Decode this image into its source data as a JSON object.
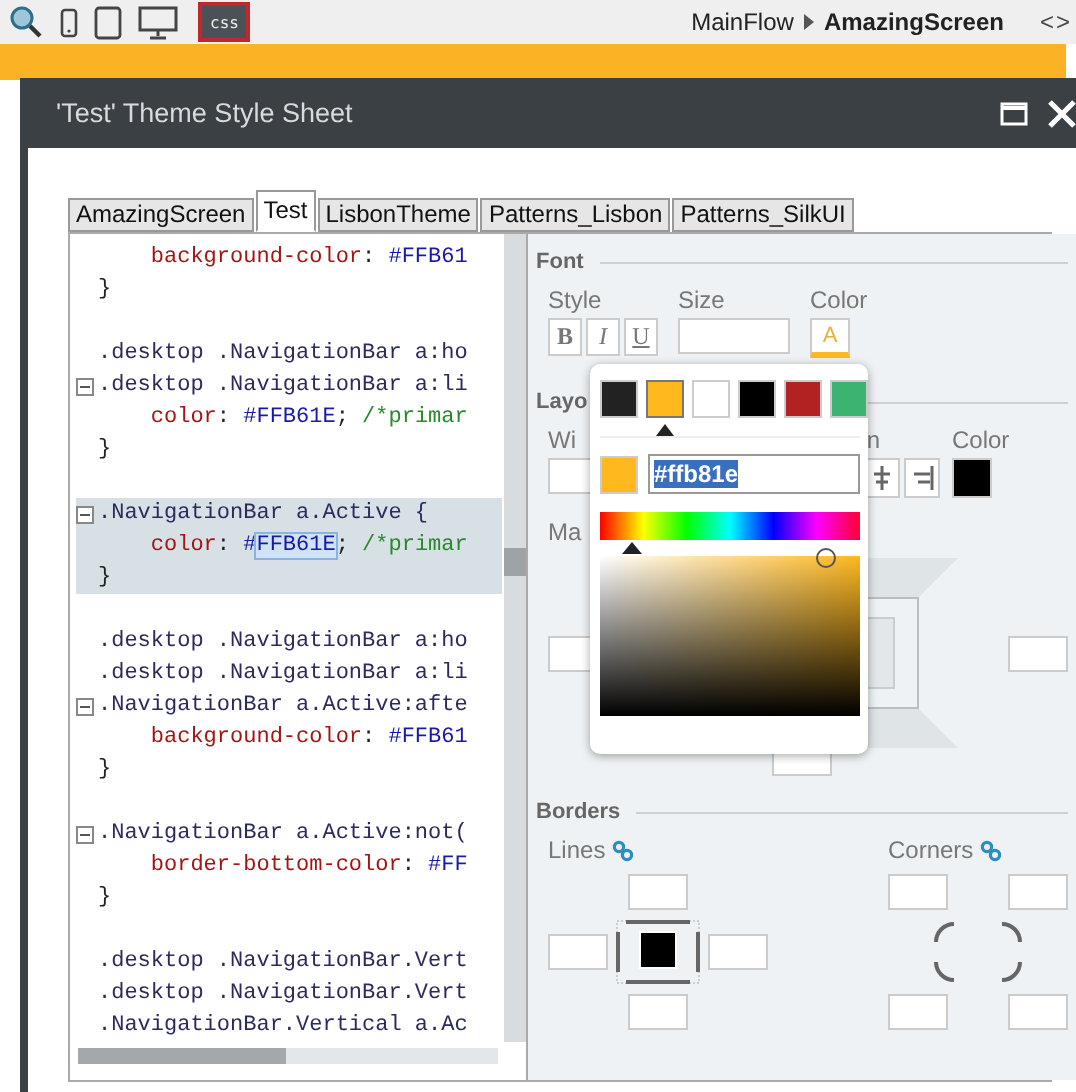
{
  "toolbar": {
    "buttons": [
      {
        "kind": "search",
        "selected": false
      },
      {
        "kind": "phone",
        "selected": false
      },
      {
        "kind": "tablet",
        "selected": false
      },
      {
        "kind": "desktop",
        "selected": false
      },
      {
        "kind": "css",
        "label": "css",
        "selected": true
      }
    ]
  },
  "breadcrumb": {
    "items": [
      "MainFlow",
      "AmazingScreen"
    ],
    "toggle": "<>"
  },
  "dialog": {
    "title": "'Test' Theme Style Sheet"
  },
  "tabs": [
    {
      "label": "AmazingScreen",
      "selected": false
    },
    {
      "label": "Test",
      "selected": true
    },
    {
      "label": "LisbonTheme",
      "selected": false
    },
    {
      "label": "Patterns_Lisbon",
      "selected": false
    },
    {
      "label": "Patterns_SilkUI",
      "selected": false
    }
  ],
  "code": {
    "lines": [
      {
        "fold": false,
        "highlighted": false,
        "parts": [
          {
            "kind": "prop",
            "text": "    background-color"
          },
          {
            "kind": "plain",
            "text": ": "
          },
          {
            "kind": "value",
            "text": "#FFB61"
          }
        ]
      },
      {
        "fold": false,
        "highlighted": false,
        "parts": [
          {
            "kind": "plain",
            "text": "}"
          }
        ]
      },
      {
        "fold": false,
        "highlighted": false
      },
      {
        "fold": false,
        "highlighted": false,
        "parts": [
          {
            "kind": "selector",
            "text": ".desktop .NavigationBar a:ho"
          }
        ]
      },
      {
        "fold": true,
        "highlighted": false,
        "parts": [
          {
            "kind": "selector",
            "text": ".desktop .NavigationBar a:li"
          }
        ]
      },
      {
        "fold": false,
        "highlighted": false,
        "parts": [
          {
            "kind": "prop",
            "text": "    color"
          },
          {
            "kind": "plain",
            "text": ": "
          },
          {
            "kind": "value",
            "text": "#FFB61E"
          },
          {
            "kind": "plain",
            "text": "; "
          },
          {
            "kind": "comment",
            "text": "/*primar"
          }
        ]
      },
      {
        "fold": false,
        "highlighted": false,
        "parts": [
          {
            "kind": "plain",
            "text": "}"
          }
        ]
      },
      {
        "fold": false,
        "highlighted": false
      },
      {
        "fold": true,
        "highlighted": true,
        "parts": [
          {
            "kind": "selector",
            "text": ".NavigationBar a.Active {"
          }
        ]
      },
      {
        "fold": false,
        "highlighted": true,
        "parts": [
          {
            "kind": "prop",
            "text": "    color"
          },
          {
            "kind": "plain",
            "text": ": "
          },
          {
            "kind": "value",
            "text": "#"
          },
          {
            "kind": "selected",
            "text": "FFB61E"
          },
          {
            "kind": "plain",
            "text": "; "
          },
          {
            "kind": "comment",
            "text": "/*primar"
          }
        ]
      },
      {
        "fold": false,
        "highlighted": true,
        "parts": [
          {
            "kind": "plain",
            "text": "}"
          }
        ]
      },
      {
        "fold": false,
        "highlighted": false
      },
      {
        "fold": false,
        "highlighted": false,
        "parts": [
          {
            "kind": "selector",
            "text": ".desktop .NavigationBar a:ho"
          }
        ]
      },
      {
        "fold": false,
        "highlighted": false,
        "parts": [
          {
            "kind": "selector",
            "text": ".desktop .NavigationBar a:li"
          }
        ]
      },
      {
        "fold": true,
        "highlighted": false,
        "parts": [
          {
            "kind": "selector",
            "text": ".NavigationBar a.Active:afte"
          }
        ]
      },
      {
        "fold": false,
        "highlighted": false,
        "parts": [
          {
            "kind": "prop",
            "text": "    background-color"
          },
          {
            "kind": "plain",
            "text": ": "
          },
          {
            "kind": "value",
            "text": "#FFB61"
          }
        ]
      },
      {
        "fold": false,
        "highlighted": false,
        "parts": [
          {
            "kind": "plain",
            "text": "}"
          }
        ]
      },
      {
        "fold": false,
        "highlighted": false
      },
      {
        "fold": true,
        "highlighted": false,
        "parts": [
          {
            "kind": "selector",
            "text": ".NavigationBar a.Active:not("
          }
        ]
      },
      {
        "fold": false,
        "highlighted": false,
        "parts": [
          {
            "kind": "prop",
            "text": "    border-bottom-color"
          },
          {
            "kind": "plain",
            "text": ": "
          },
          {
            "kind": "value",
            "text": "#FF"
          }
        ]
      },
      {
        "fold": false,
        "highlighted": false,
        "parts": [
          {
            "kind": "plain",
            "text": "}"
          }
        ]
      },
      {
        "fold": false,
        "highlighted": false
      },
      {
        "fold": false,
        "highlighted": false,
        "parts": [
          {
            "kind": "selector",
            "text": ".desktop .NavigationBar.Vert"
          }
        ]
      },
      {
        "fold": false,
        "highlighted": false,
        "parts": [
          {
            "kind": "selector",
            "text": ".desktop .NavigationBar.Vert"
          }
        ]
      },
      {
        "fold": false,
        "highlighted": false,
        "parts": [
          {
            "kind": "selector",
            "text": ".NavigationBar.Vertical a.Ac"
          }
        ]
      }
    ]
  },
  "font": {
    "heading": "Font",
    "style_label": "Style",
    "style_buttons": [
      {
        "kind": "bold",
        "label": "B"
      },
      {
        "kind": "italic",
        "label": "I"
      },
      {
        "kind": "underline",
        "label": "U"
      }
    ],
    "size_label": "Size",
    "color_label": "Color",
    "color_button": "A"
  },
  "layout": {
    "heading": "Layo",
    "width_label": "Wi",
    "align_label": "n",
    "color_label": "Color",
    "margin_label": "Ma"
  },
  "borders": {
    "heading": "Borders",
    "lines_label": "Lines",
    "corners_label": "Corners"
  },
  "color_picker": {
    "swatches": [
      {
        "color": "#222222",
        "selected": false
      },
      {
        "color": "#ffb81e",
        "selected": true
      },
      {
        "color": "#ffffff",
        "selected": false
      },
      {
        "color": "#000000",
        "selected": false
      },
      {
        "color": "#b22222",
        "selected": false
      },
      {
        "color": "#3cb371",
        "selected": false
      }
    ],
    "hex": "#ffb81e",
    "hue": {
      "level": 0.12
    }
  }
}
